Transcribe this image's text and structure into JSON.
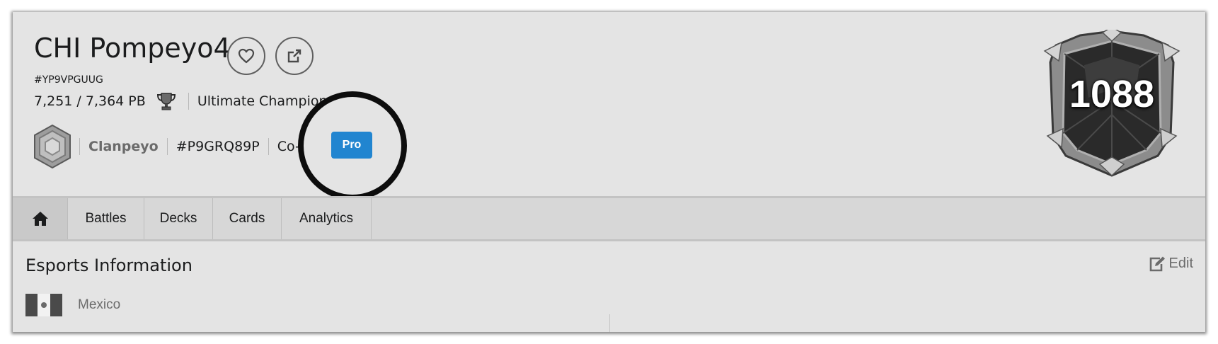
{
  "player": {
    "name": "CHI Pompeyo4",
    "tag": "#YP9VPGUUG",
    "trophies": "7,251 / 7,364 PB",
    "arena": "Ultimate Champion",
    "badge": "Pro",
    "league_number": "1088"
  },
  "clan": {
    "name": "Clanpeyo",
    "tag": "#P9GRQ89P",
    "role": "Co-Leader"
  },
  "tabs": [
    {
      "icon": "home-icon"
    },
    {
      "label": "Battles"
    },
    {
      "label": "Decks"
    },
    {
      "label": "Cards"
    },
    {
      "label": "Analytics"
    }
  ],
  "esports": {
    "title": "Esports Information",
    "edit_label": "Edit",
    "country": "Mexico"
  },
  "colors": {
    "pro_badge": "#2185d0",
    "background": "#e4e4e4"
  }
}
